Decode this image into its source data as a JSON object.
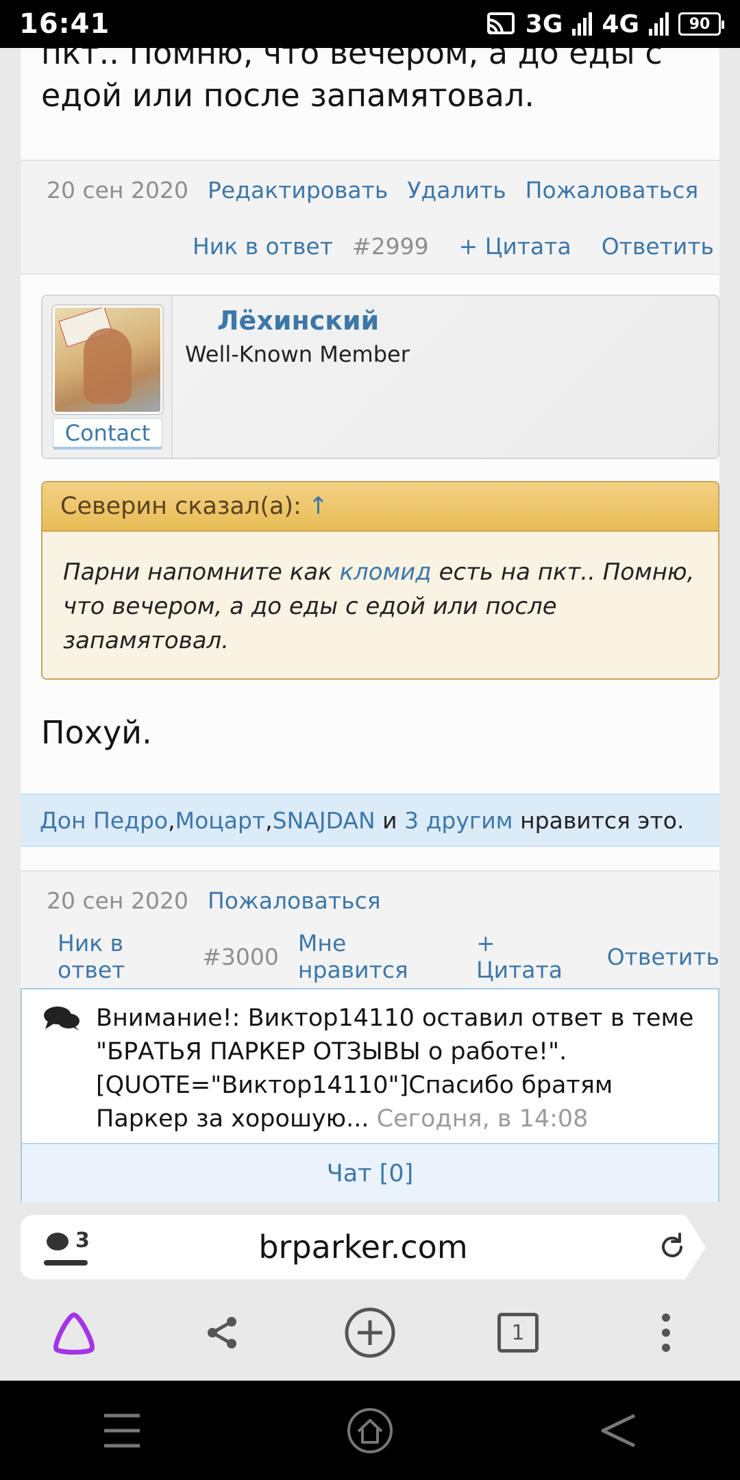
{
  "status_bar": {
    "time": "16:41",
    "network": "3G",
    "network_badge": "3G",
    "network2": "4G",
    "battery": "90"
  },
  "previous_post": {
    "text_partial_top": "пкт.. Помню, что вечером, а до еды с",
    "text_line": "едой или после запамятовал.",
    "date": "20 сен 2020",
    "actions_row1": [
      "Редактировать",
      "Удалить",
      "Пожаловаться"
    ],
    "nick_reply": "Ник в ответ",
    "post_number": "#2999",
    "quote": "+ Цитата",
    "reply": "Ответить"
  },
  "post": {
    "user": {
      "name": "Лёхинский",
      "title": "Well-Known Member",
      "contact_label": "Contact"
    },
    "quote_box": {
      "author_line": "Северин сказал(а):",
      "arrow": "↑",
      "text_before_link": "Парни напомните как ",
      "link_text": "кломид",
      "text_after_link": " есть на пкт.. Помню, что вечером, а до еды с едой или после запамятовал."
    },
    "reply_text": "Похуй.",
    "likes": {
      "user1": "Дон Педро",
      "sep1": ", ",
      "user2": "Моцарт",
      "sep2": ", ",
      "user3": "SNAJDAN",
      "conj": " и ",
      "others": "3 другим",
      "suffix": " нравится это."
    },
    "date": "20 сен 2020",
    "report": "Пожаловаться",
    "nick_reply": "Ник в ответ",
    "post_number": "#3000",
    "like": "Мне нравится",
    "quote": "+ Цитата",
    "reply": "Ответить"
  },
  "notification": {
    "icon": "chat-bubbles-icon",
    "text": "Внимание!: Виктор14110 оставил ответ в теме \"БРАТЬЯ ПАРКЕР ОТЗЫВЫ о работе!\". [QUOTE=\"Виктор14110\"]Спасибо братям Паркер за хорошую... ",
    "time": "Сегодня, в 14:08",
    "chat_label": "Чат [0]"
  },
  "browser": {
    "tab_count": "3",
    "url": "brparker.com",
    "tabs_button_count": "1"
  },
  "colors": {
    "link": "#3c77a9",
    "quote_header": "#e8bd55",
    "likes_bg": "#dcebf8",
    "alice_purple": "#a335e6"
  }
}
